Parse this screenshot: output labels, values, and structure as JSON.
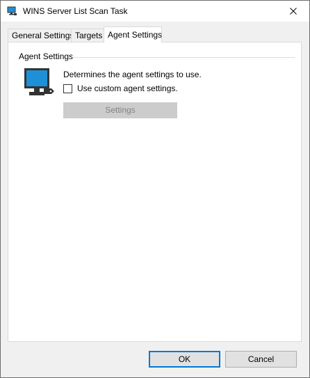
{
  "window": {
    "title": "WINS Server List Scan Task",
    "close_glyph": "✕"
  },
  "tabs": [
    {
      "label": "General Settings",
      "active": false
    },
    {
      "label": "Targets",
      "active": false
    },
    {
      "label": "Agent Settings",
      "active": true
    }
  ],
  "agent_settings": {
    "group_title": "Agent Settings",
    "description": "Determines the agent settings to use.",
    "checkbox_label": "Use custom agent settings.",
    "checkbox_checked": false,
    "settings_button_label": "Settings",
    "icon": "monitor-tag-icon"
  },
  "footer": {
    "ok_label": "OK",
    "cancel_label": "Cancel"
  },
  "colors": {
    "accent": "#0078d7",
    "monitor": "#1e90d6",
    "dark": "#333333",
    "disabled_button": "#cccccc"
  }
}
